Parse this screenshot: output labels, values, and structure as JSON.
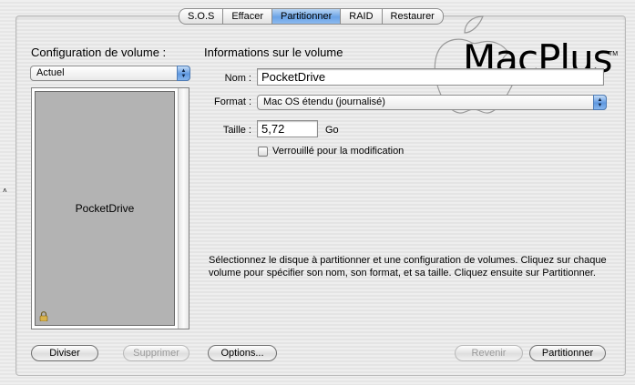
{
  "tabs": [
    {
      "label": "S.O.S",
      "selected": false
    },
    {
      "label": "Effacer",
      "selected": false
    },
    {
      "label": "Partitionner",
      "selected": true
    },
    {
      "label": "RAID",
      "selected": false
    },
    {
      "label": "Restaurer",
      "selected": false
    }
  ],
  "left": {
    "heading": "Configuration de volume :",
    "scheme_select": "Actuel",
    "volume_name": "PocketDrive"
  },
  "info": {
    "heading": "Informations sur le volume",
    "name_label": "Nom :",
    "name_value": "PocketDrive",
    "format_label": "Format :",
    "format_value": "Mac OS étendu (journalisé)",
    "size_label": "Taille :",
    "size_value": "5,72",
    "size_unit": "Go",
    "locked_label": "Verrouillé pour la modification",
    "description": "Sélectionnez le disque à partitionner et une configuration de volumes. Cliquez sur chaque volume pour spécifier son nom, son format, et sa taille. Cliquez ensuite sur Partitionner."
  },
  "buttons": {
    "split": "Diviser",
    "delete": "Supprimer",
    "options": "Options...",
    "revert": "Revenir",
    "partition": "Partitionner"
  },
  "logo": {
    "text": "MacPlus",
    "tm": "TM"
  },
  "colors": {
    "selected_tab": "#6aa3e6",
    "volume_fill": "#b3b3b3"
  }
}
